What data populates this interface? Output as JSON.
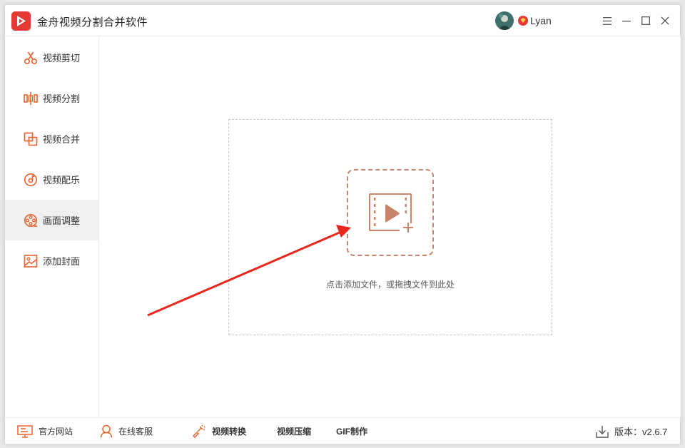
{
  "app": {
    "title": "金舟视频分割合并软件"
  },
  "user": {
    "name": "Lyan"
  },
  "sidebar": {
    "items": [
      {
        "label": "视频剪切"
      },
      {
        "label": "视频分割"
      },
      {
        "label": "视频合并"
      },
      {
        "label": "视频配乐"
      },
      {
        "label": "画面调整"
      },
      {
        "label": "添加封面"
      }
    ],
    "active_index": 4
  },
  "main": {
    "hint": "点击添加文件，或拖拽文件到此处"
  },
  "footer": {
    "website": "官方网站",
    "service": "在线客服",
    "convert": "视频转换",
    "compress": "视频压缩",
    "gif": "GIF制作",
    "version": "版本：v2.6.7"
  },
  "colors": {
    "accent": "#e8612c",
    "brand_red": "#e53935",
    "icon_brown": "#c8846a",
    "arrow_red": "#e8261c"
  }
}
